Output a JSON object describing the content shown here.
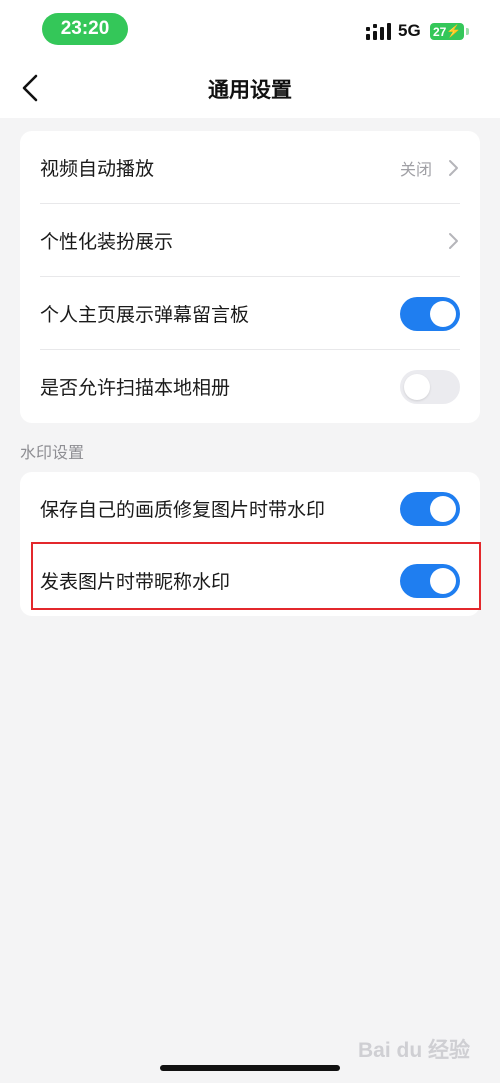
{
  "status_bar": {
    "time": "23:20",
    "network": "5G",
    "battery": "27"
  },
  "nav": {
    "title": "通用设置"
  },
  "general_settings": [
    {
      "label": "视频自动播放",
      "value": "关闭",
      "control": "chevron"
    },
    {
      "label": "个性化装扮展示",
      "control": "chevron"
    },
    {
      "label": "个人主页展示弹幕留言板",
      "control": "toggle",
      "on": true
    },
    {
      "label": "是否允许扫描本地相册",
      "control": "toggle",
      "on": false
    }
  ],
  "watermark_section": {
    "header": "水印设置",
    "items": [
      {
        "label": "保存自己的画质修复图片时带水印",
        "control": "toggle",
        "on": true
      },
      {
        "label": "发表图片时带昵称水印",
        "control": "toggle",
        "on": true
      }
    ]
  },
  "watermark_text": "Bai du 经验",
  "colors": {
    "accent": "#1f7ef0",
    "status_green": "#34c759",
    "highlight": "#e3282c"
  }
}
